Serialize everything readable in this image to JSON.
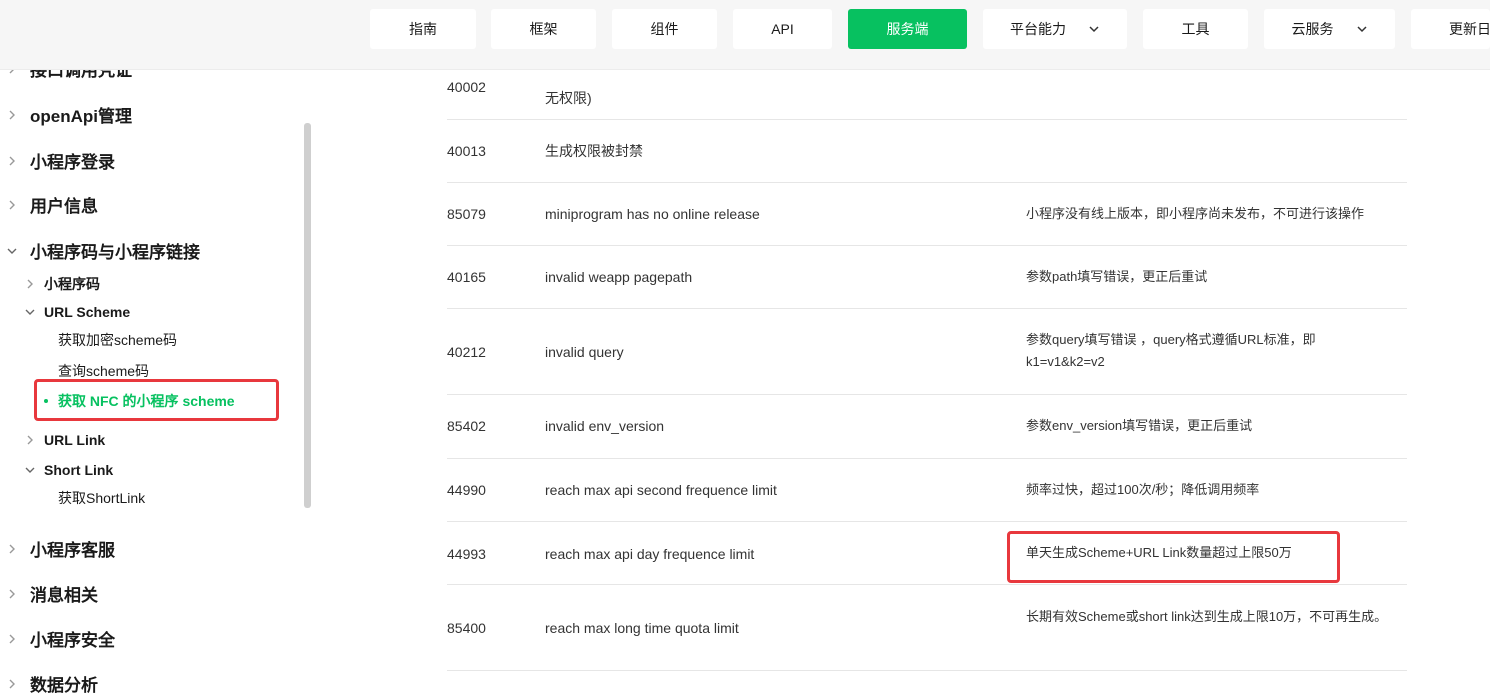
{
  "topnav": {
    "items": [
      {
        "label": "指南"
      },
      {
        "label": "框架"
      },
      {
        "label": "组件"
      },
      {
        "label": "API"
      },
      {
        "label": "服务端",
        "active": true
      },
      {
        "label": "平台能力",
        "dropdown": true
      },
      {
        "label": "工具"
      },
      {
        "label": "云服务",
        "dropdown": true
      },
      {
        "label": "更新日"
      }
    ],
    "accent_color": "#07c160"
  },
  "sidebar": {
    "top_partial": "接口调用凭证",
    "items": [
      {
        "label": "openApi管理",
        "level": 1
      },
      {
        "label": "小程序登录",
        "level": 1
      },
      {
        "label": "用户信息",
        "level": 1
      },
      {
        "label": "小程序码与小程序链接",
        "level": 1,
        "expanded": true
      },
      {
        "label": "小程序码",
        "level": 2
      },
      {
        "label": "URL Scheme",
        "level": 2,
        "expanded": true
      },
      {
        "label": "获取加密scheme码",
        "level": 3
      },
      {
        "label": "查询scheme码",
        "level": 3
      },
      {
        "label": "获取 NFC 的小程序 scheme",
        "level": 3,
        "active": true
      },
      {
        "label": "URL Link",
        "level": 2
      },
      {
        "label": "Short Link",
        "level": 2,
        "expanded": true
      },
      {
        "label": "获取ShortLink",
        "level": 3
      },
      {
        "label": "小程序客服",
        "level": 1
      },
      {
        "label": "消息相关",
        "level": 1
      },
      {
        "label": "小程序安全",
        "level": 1
      },
      {
        "label": "数据分析",
        "level": 1
      }
    ]
  },
  "table": {
    "rows": [
      {
        "code": "40002",
        "msg": "",
        "desc": "",
        "msg_partial": "无权限)"
      },
      {
        "code": "40013",
        "msg": "生成权限被封禁",
        "desc": ""
      },
      {
        "code": "85079",
        "msg": "miniprogram has no online release",
        "desc": "小程序没有线上版本，即小程序尚未发布，不可进行该操作"
      },
      {
        "code": "40165",
        "msg": "invalid weapp pagepath",
        "desc": "参数path填写错误，更正后重试"
      },
      {
        "code": "40212",
        "msg": "invalid query",
        "desc": "参数query填写错误 ，query格式遵循URL标准，即k1=v1&k2=v2"
      },
      {
        "code": "85402",
        "msg": "invalid env_version",
        "desc": "参数env_version填写错误，更正后重试"
      },
      {
        "code": "44990",
        "msg": "reach max api second frequence limit",
        "desc": "频率过快，超过100次/秒；降低调用频率"
      },
      {
        "code": "44993",
        "msg": "reach max api day frequence limit",
        "desc": "单天生成Scheme+URL Link数量超过上限50万"
      },
      {
        "code": "85400",
        "msg": "reach max long time quota limit",
        "desc": "长期有效Scheme或short link达到生成上限10万，不可再生成。"
      }
    ]
  }
}
